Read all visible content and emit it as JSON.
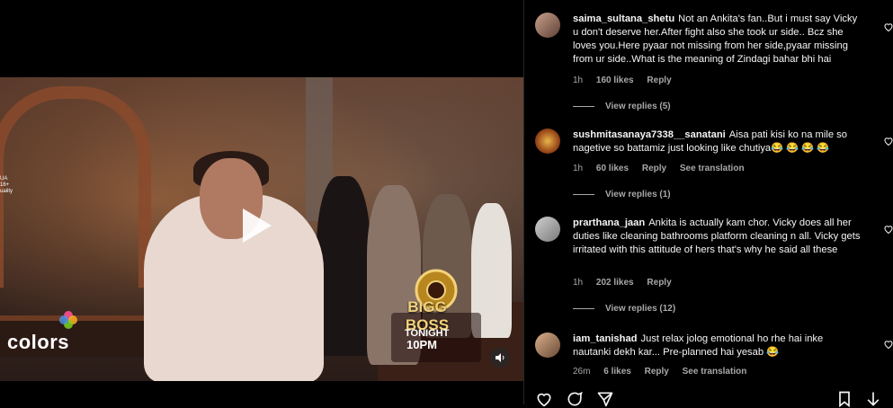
{
  "video": {
    "channel_logo": "colors",
    "badge_title": "BIGG BOSS",
    "badge_tonight": "TONIGHT",
    "badge_time": "10PM",
    "channel_tag": "UA\n16+\nuality"
  },
  "comments": [
    {
      "username": "saima_sultana_shetu",
      "text": "Not an Ankita's fan..But i must say Vicky u don't deserve her.After fight also she took ur side.. Bcz she loves you.Here pyaar not missing from her side,pyaar missing from ur side..What is the meaning of Zindagi bahar bhi hai",
      "time": "1h",
      "likes": "160 likes",
      "reply": "Reply",
      "view_replies": "View replies (5)"
    },
    {
      "username": "sushmitasanaya7338__sanatani",
      "text": "Aisa pati kisi ko na mile so nagetive so battamiz just looking like chutiya😂 😂 😂 😂",
      "time": "1h",
      "likes": "60 likes",
      "reply": "Reply",
      "translation": "See translation",
      "view_replies": "View replies (1)"
    },
    {
      "username": "prarthana_jaan",
      "text": "Ankita is actually kam chor. Vicky does all her duties like cleaning bathrooms platform cleaning n all. Vicky gets irritated with this attitude of hers that's why he said all these",
      "time": "1h",
      "likes": "202 likes",
      "reply": "Reply",
      "view_replies": "View replies (12)"
    },
    {
      "username": "iam_tanishad",
      "text": "Just relax jolog emotional ho rhe hai inke nautanki dekh kar... Pre-planned hai yesab 😂",
      "time": "26m",
      "likes": "6 likes",
      "reply": "Reply",
      "translation": "See translation"
    }
  ],
  "colors": {
    "bg": "#000000",
    "text": "#f5f5f5",
    "meta": "#a8a8a8"
  },
  "icons": [
    "heart-icon",
    "comment-icon",
    "share-icon",
    "bookmark-icon",
    "down-arrow-icon",
    "play-icon",
    "mute-icon"
  ]
}
